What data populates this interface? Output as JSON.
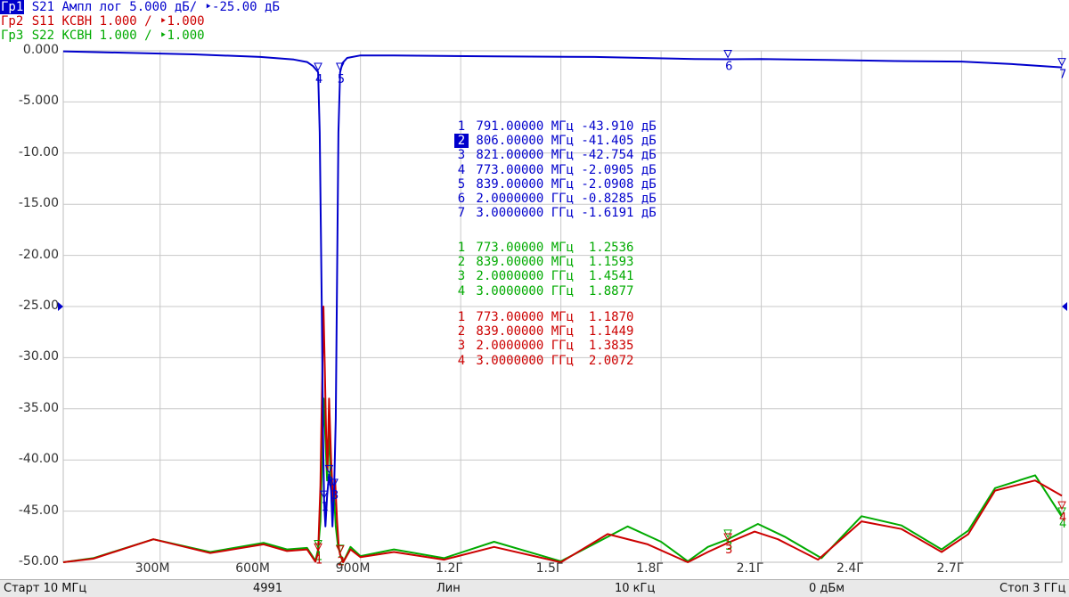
{
  "header": {
    "trace1": {
      "tag": "Гр1",
      "text": " S21 Ампл лог 5.000 дБ/ ‣-25.00 дБ"
    },
    "trace2": {
      "tag": "Гр2",
      "text": " S11 КСВН 1.000 / ‣1.000"
    },
    "trace3": {
      "tag": "Гр3",
      "text": " S22 КСВН 1.000 / ‣1.000"
    }
  },
  "colors": {
    "s21": "#0000cc",
    "s11": "#cc0000",
    "s22": "#00aa00",
    "grid": "#c8c8c8"
  },
  "chart_data": {
    "type": "line",
    "xlim": [
      10,
      3000
    ],
    "ylim": [
      -50,
      0
    ],
    "y_ticks": [
      "0.000",
      "-5.000",
      "-10.00",
      "-15.00",
      "-20.00",
      "-25.00",
      "-30.00",
      "-35.00",
      "-40.00",
      "-45.00",
      "-50.00"
    ],
    "x_ticks": [
      {
        "label": "300М",
        "x": 300
      },
      {
        "label": "600М",
        "x": 600
      },
      {
        "label": "900М",
        "x": 900
      },
      {
        "label": "1.2Г",
        "x": 1200
      },
      {
        "label": "1.5Г",
        "x": 1500
      },
      {
        "label": "1.8Г",
        "x": 1800
      },
      {
        "label": "2.1Г",
        "x": 2100
      },
      {
        "label": "2.4Г",
        "x": 2400
      },
      {
        "label": "2.7Г",
        "x": 2700
      }
    ],
    "reference_level": -25.0,
    "series": [
      {
        "key": "s21",
        "color": "#0000cc",
        "display": "dB",
        "scale": 5.0,
        "ref_value": -25.0,
        "x": [
          10,
          200,
          400,
          600,
          700,
          740,
          758,
          766,
          773,
          778,
          784,
          788,
          791,
          795,
          800,
          806,
          812,
          816,
          821,
          826,
          830,
          834,
          839,
          846,
          860,
          900,
          1000,
          1300,
          1600,
          1900,
          2000,
          2100,
          2300,
          2500,
          2700,
          2850,
          3000
        ],
        "y": [
          -0.05,
          -0.2,
          -0.35,
          -0.6,
          -0.85,
          -1.1,
          -1.5,
          -1.8,
          -2.09,
          -8,
          -25,
          -38,
          -43.91,
          -46.5,
          -43.5,
          -41.4,
          -43,
          -46.5,
          -42.75,
          -36,
          -22,
          -8,
          -2.09,
          -1.2,
          -0.7,
          -0.45,
          -0.45,
          -0.55,
          -0.6,
          -0.8,
          -0.83,
          -0.8,
          -0.9,
          -1.0,
          -1.05,
          -1.3,
          -1.62
        ]
      },
      {
        "key": "s11",
        "color": "#cc0000",
        "display": "VSWR",
        "scale": 1.0,
        "ref_value": 1.0,
        "x": [
          10,
          100,
          280,
          450,
          610,
          680,
          740,
          765,
          773,
          780,
          785,
          789,
          793,
          797,
          801,
          806,
          812,
          818,
          824,
          830,
          835,
          839,
          848,
          870,
          900,
          1000,
          1150,
          1300,
          1500,
          1640,
          1760,
          1880,
          1940,
          2000,
          2080,
          2150,
          2270,
          2400,
          2520,
          2640,
          2720,
          2800,
          2920,
          3000
        ],
        "y": [
          1.0,
          1.07,
          1.45,
          1.18,
          1.35,
          1.22,
          1.25,
          1.01,
          1.187,
          2.5,
          4.5,
          6.0,
          4.8,
          3.5,
          2.8,
          4.2,
          3.0,
          2.2,
          2.6,
          1.8,
          1.3,
          1.145,
          1.0,
          1.25,
          1.1,
          1.2,
          1.05,
          1.3,
          1.0,
          1.55,
          1.35,
          1.0,
          1.2,
          1.38,
          1.6,
          1.45,
          1.05,
          1.8,
          1.65,
          1.2,
          1.55,
          2.4,
          2.6,
          2.3
        ]
      },
      {
        "key": "s22",
        "color": "#00aa00",
        "display": "VSWR",
        "scale": 1.0,
        "ref_value": 1.0,
        "x": [
          10,
          100,
          280,
          450,
          610,
          680,
          740,
          765,
          773,
          780,
          785,
          790,
          795,
          800,
          805,
          810,
          815,
          820,
          826,
          832,
          839,
          848,
          870,
          900,
          1000,
          1150,
          1300,
          1500,
          1700,
          1800,
          1880,
          1940,
          2000,
          2090,
          2170,
          2280,
          2400,
          2520,
          2640,
          2720,
          2800,
          2920,
          3000
        ],
        "y": [
          1.0,
          1.08,
          1.45,
          1.2,
          1.38,
          1.25,
          1.28,
          1.03,
          1.254,
          1.8,
          3.0,
          4.2,
          3.4,
          2.6,
          3.6,
          2.8,
          2.0,
          2.4,
          1.7,
          1.35,
          1.159,
          1.0,
          1.3,
          1.12,
          1.25,
          1.08,
          1.4,
          1.02,
          1.7,
          1.4,
          1.02,
          1.3,
          1.45,
          1.75,
          1.5,
          1.08,
          1.9,
          1.72,
          1.25,
          1.62,
          2.45,
          2.7,
          1.89
        ]
      }
    ],
    "s21_markers": [
      {
        "num": "1",
        "x": 791,
        "y": -43.91,
        "active": false,
        "readout": " 791.00000 МГц -43.910 дБ"
      },
      {
        "num": "2",
        "x": 806,
        "y": -41.405,
        "active": true,
        "readout": " 806.00000 МГц -41.405 дБ"
      },
      {
        "num": "3",
        "x": 821,
        "y": -42.754,
        "active": false,
        "readout": " 821.00000 МГц -42.754 дБ"
      },
      {
        "num": "4",
        "x": 773,
        "y": -2.0905,
        "active": false,
        "readout": " 773.00000 МГц -2.0905 дБ"
      },
      {
        "num": "5",
        "x": 839,
        "y": -2.0908,
        "active": false,
        "readout": " 839.00000 МГц -2.0908 дБ"
      },
      {
        "num": "6",
        "x": 2000,
        "y": -0.8285,
        "active": false,
        "readout": " 2.0000000 ГГц -0.8285 дБ"
      },
      {
        "num": "7",
        "x": 3000,
        "y": -1.6191,
        "active": false,
        "readout": " 3.0000000 ГГц -1.6191 дБ"
      }
    ],
    "s22_markers": [
      {
        "num": "1",
        "x": 773,
        "y": 1.2536,
        "readout": " 773.00000 МГц  1.2536"
      },
      {
        "num": "2",
        "x": 839,
        "y": 1.1593,
        "readout": " 839.00000 МГц  1.1593"
      },
      {
        "num": "3",
        "x": 2000,
        "y": 1.4541,
        "readout": " 2.0000000 ГГц  1.4541"
      },
      {
        "num": "4",
        "x": 3000,
        "y": 1.8877,
        "readout": " 3.0000000 ГГц  1.8877"
      }
    ],
    "s11_markers": [
      {
        "num": "1",
        "x": 773,
        "y": 1.187,
        "readout": " 773.00000 МГц  1.1870"
      },
      {
        "num": "2",
        "x": 839,
        "y": 1.1449,
        "readout": " 839.00000 МГц  1.1449"
      },
      {
        "num": "3",
        "x": 2000,
        "y": 1.3835,
        "readout": " 2.0000000 ГГц  1.3835"
      },
      {
        "num": "4",
        "x": 3000,
        "y": 2.0072,
        "readout": " 3.0000000 ГГц  2.0072"
      }
    ]
  },
  "statusbar": {
    "start": "Старт 10 МГц",
    "points": "4991",
    "sweep_type": "Лин",
    "ifbw": "10 кГц",
    "power": "0 дБм",
    "stop": "Стоп 3 ГГц"
  }
}
